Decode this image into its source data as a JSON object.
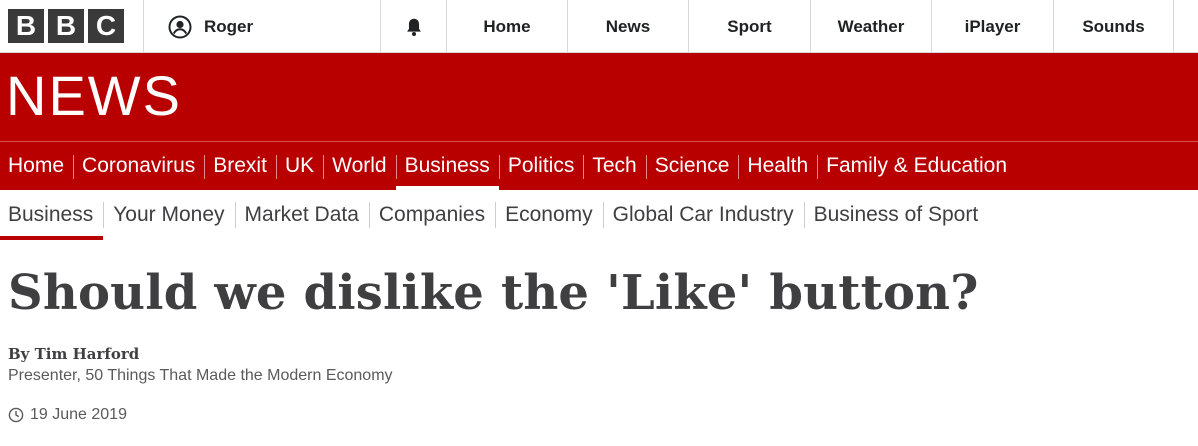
{
  "brand": {
    "letters": [
      "B",
      "B",
      "C"
    ]
  },
  "account": {
    "name": "Roger",
    "icon": "user-account-icon"
  },
  "notifications": {
    "icon": "bell-icon"
  },
  "global_nav": [
    "Home",
    "News",
    "Sport",
    "Weather",
    "iPlayer",
    "Sounds"
  ],
  "news_banner": {
    "wordmark": "NEWS",
    "background_color": "#b80000"
  },
  "section_nav": {
    "items": [
      "Home",
      "Coronavirus",
      "Brexit",
      "UK",
      "World",
      "Business",
      "Politics",
      "Tech",
      "Science",
      "Health",
      "Family & Education"
    ],
    "active": "Business"
  },
  "sub_nav": {
    "items": [
      "Business",
      "Your Money",
      "Market Data",
      "Companies",
      "Economy",
      "Global Car Industry",
      "Business of Sport"
    ],
    "active": "Business"
  },
  "article": {
    "headline": "Should we dislike the 'Like' button?",
    "byline_name": "By Tim Harford",
    "byline_role": "Presenter, 50 Things That Made the Modern Economy",
    "date": "19 June 2019",
    "date_icon": "clock-icon"
  }
}
